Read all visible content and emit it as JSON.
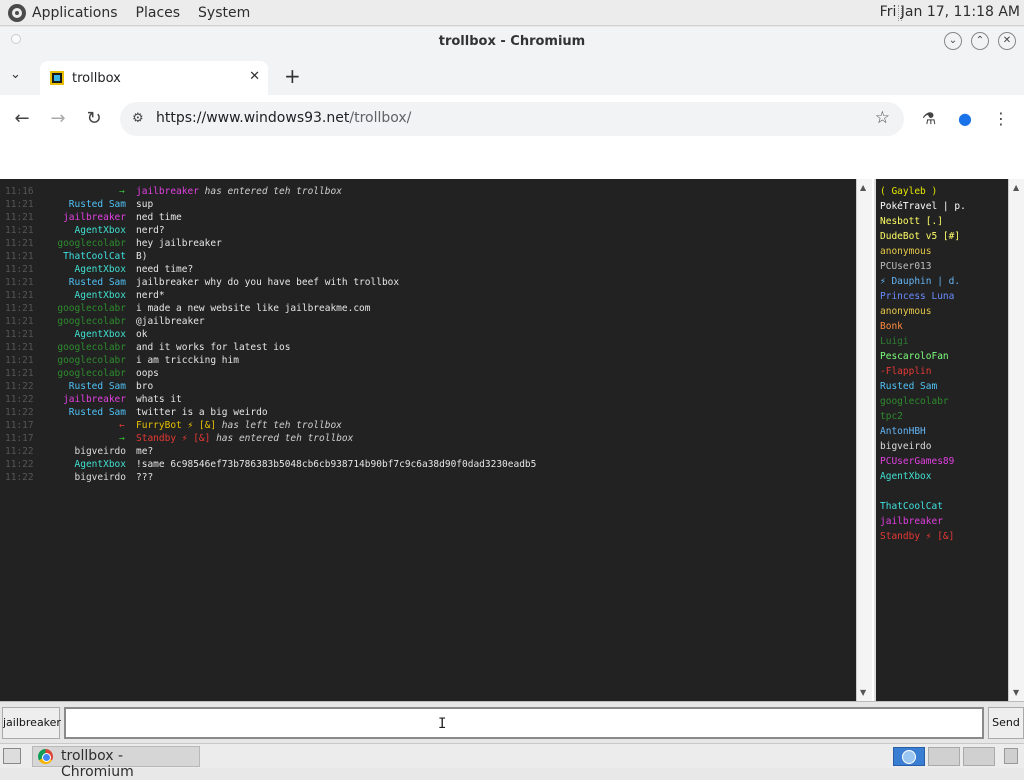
{
  "top_panel": {
    "menus": [
      "Applications",
      "Places",
      "System"
    ],
    "clock": "Fri Jan 17, 11:18 AM"
  },
  "window": {
    "title": "trollbox - Chromium"
  },
  "browser": {
    "tab_label": "trollbox",
    "url_scheme": "https://",
    "url_host": "www.windows93.net",
    "url_path": "/trollbox/"
  },
  "chat": {
    "messages": [
      {
        "time": "11:16",
        "nick": "",
        "arrow": "→",
        "text": "",
        "sys_nick": "jailbreaker",
        "sys_nick_color": "#e040e0",
        "sys_text": " has entered teh trollbox"
      },
      {
        "time": "11:21",
        "nick": "Rusted Sam",
        "color": "#4fc3f7",
        "text": "sup"
      },
      {
        "time": "11:21",
        "nick": "jailbreaker",
        "color": "#e040e0",
        "text": "ned time"
      },
      {
        "time": "11:21",
        "nick": "AgentXbox",
        "color": "#40e0d0",
        "text": "nerd?"
      },
      {
        "time": "11:21",
        "nick": "googlecolabr",
        "color": "#2e8b2e",
        "text": "hey jailbreaker"
      },
      {
        "time": "11:21",
        "nick": "ThatCoolCat",
        "color": "#40e0e0",
        "text": "B)"
      },
      {
        "time": "11:21",
        "nick": "AgentXbox",
        "color": "#40e0d0",
        "text": "need time?"
      },
      {
        "time": "11:21",
        "nick": "Rusted Sam",
        "color": "#4fc3f7",
        "text": "jailbreaker why do you have beef with trollbox"
      },
      {
        "time": "11:21",
        "nick": "AgentXbox",
        "color": "#40e0d0",
        "text": "nerd*"
      },
      {
        "time": "11:21",
        "nick": "googlecolabr",
        "color": "#2e8b2e",
        "text": "i made a new website like jailbreakme.com"
      },
      {
        "time": "11:21",
        "nick": "googlecolabr",
        "color": "#2e8b2e",
        "text": "@jailbreaker"
      },
      {
        "time": "11:21",
        "nick": "AgentXbox",
        "color": "#40e0d0",
        "text": "ok"
      },
      {
        "time": "11:21",
        "nick": "googlecolabr",
        "color": "#2e8b2e",
        "text": "and it works for latest ios"
      },
      {
        "time": "11:21",
        "nick": "googlecolabr",
        "color": "#2e8b2e",
        "text": "i am triccking him"
      },
      {
        "time": "11:21",
        "nick": "googlecolabr",
        "color": "#2e8b2e",
        "text": "oops"
      },
      {
        "time": "11:22",
        "nick": "Rusted Sam",
        "color": "#4fc3f7",
        "text": "bro"
      },
      {
        "time": "11:22",
        "nick": "jailbreaker",
        "color": "#e040e0",
        "text": "whats it"
      },
      {
        "time": "11:22",
        "nick": "Rusted Sam",
        "color": "#4fc3f7",
        "text": "twitter is a big weirdo"
      },
      {
        "time": "11:17",
        "nick": "",
        "arrow": "←",
        "arrow_color": "#e53935",
        "text": "",
        "sys_nick": "FurryBot ⚡ [&]",
        "sys_nick_color": "#e6c000",
        "sys_text": " has left teh trollbox"
      },
      {
        "time": "11:17",
        "nick": "",
        "arrow": "→",
        "text": "",
        "sys_nick": "Standby ⚡ [&]",
        "sys_nick_color": "#e53935",
        "sys_text": " has entered teh trollbox"
      },
      {
        "time": "11:22",
        "nick": "bigveirdo",
        "color": "#dcdcdc",
        "text": "me?"
      },
      {
        "time": "11:22",
        "nick": "AgentXbox",
        "color": "#40e0d0",
        "text": "!same 6c98546ef73b786383b5048cb6cb938714b90bf7c9c6a38d90f0dad3230eadb5"
      },
      {
        "time": "11:22",
        "nick": "bigveirdo",
        "color": "#dcdcdc",
        "text": "???"
      }
    ]
  },
  "users": [
    {
      "name": "( Gayleb )",
      "color": "#e6e600"
    },
    {
      "name": "PokéTravel | p.",
      "color": "#ffffff"
    },
    {
      "name": "Nesbott [.]",
      "color": "#ffff66"
    },
    {
      "name": "DudeBot v5 [#]",
      "color": "#ffff66"
    },
    {
      "name": "anonymous",
      "color": "#e6c84a"
    },
    {
      "name": "PCUser013",
      "color": "#bdbdbd"
    },
    {
      "name": "⚡ Dauphin | d.",
      "color": "#64b5f6"
    },
    {
      "name": "Princess Luna",
      "color": "#6a8cff"
    },
    {
      "name": "anonymous",
      "color": "#e6c84a"
    },
    {
      "name": "Bonk",
      "color": "#ff8a3d"
    },
    {
      "name": "Luigi",
      "color": "#2e7d32"
    },
    {
      "name": "PescaroloFan",
      "color": "#7cff7c"
    },
    {
      "name": "-Flapplin",
      "color": "#e53935"
    },
    {
      "name": "Rusted Sam",
      "color": "#4fc3f7"
    },
    {
      "name": "googlecolabr",
      "color": "#2e8b2e"
    },
    {
      "name": "tpc2",
      "color": "#2e8b2e"
    },
    {
      "name": "AntonHBH",
      "color": "#64b5f6"
    },
    {
      "name": "bigveirdo",
      "color": "#dcdcdc"
    },
    {
      "name": "PCUserGames89",
      "color": "#e040e0"
    },
    {
      "name": "AgentXbox",
      "color": "#40e0d0"
    },
    {
      "name": "",
      "color": "#ffffff"
    },
    {
      "name": "ThatCoolCat",
      "color": "#40e0e0"
    },
    {
      "name": "jailbreaker",
      "color": "#e040e0"
    },
    {
      "name": "Standby ⚡ [&]",
      "color": "#e53935"
    }
  ],
  "input": {
    "nick_label": "jailbreaker",
    "message_value": "",
    "send_label": "Send"
  },
  "taskbar": {
    "task_label": "trollbox - Chromium"
  }
}
